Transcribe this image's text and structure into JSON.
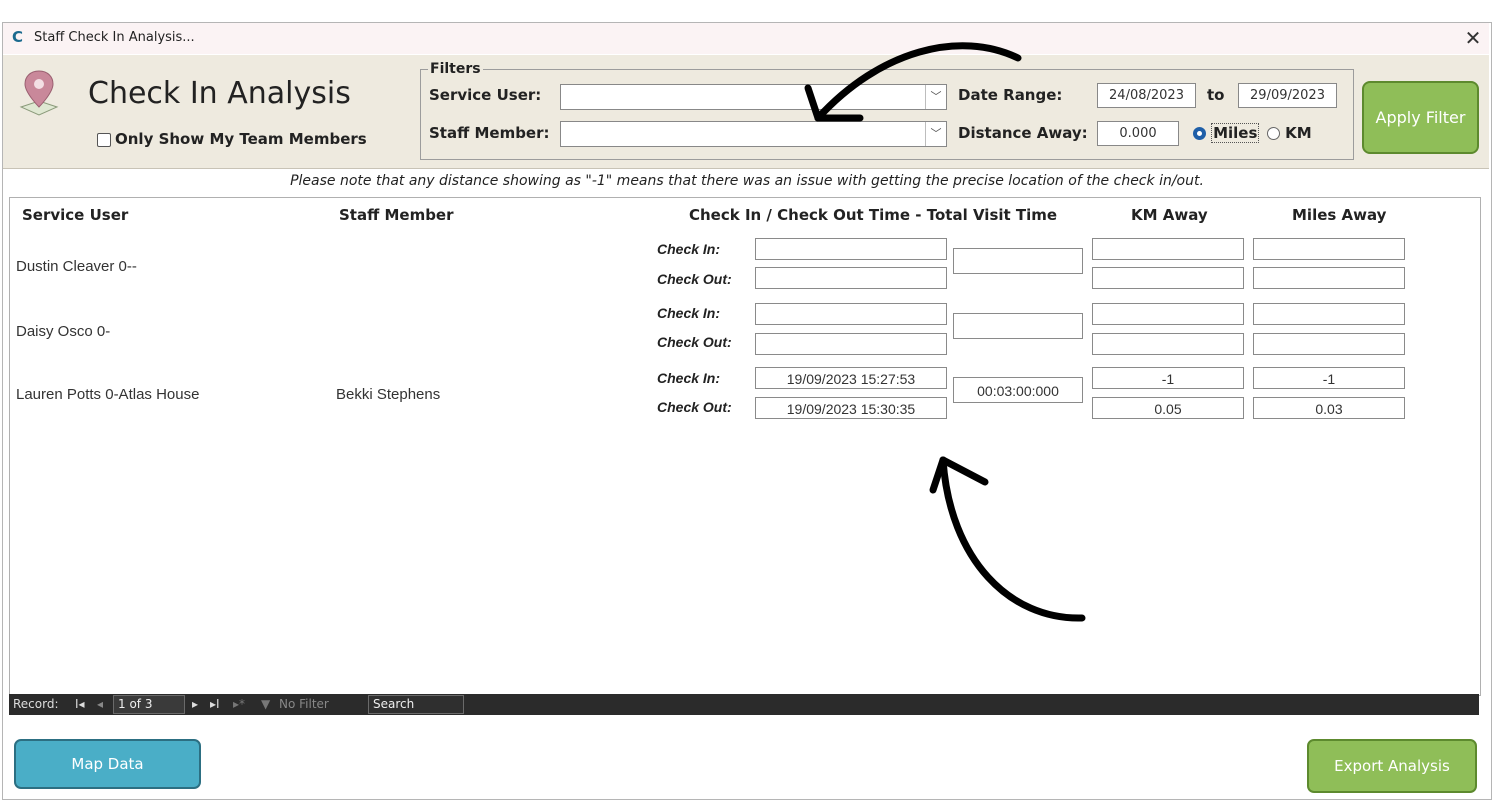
{
  "window": {
    "title": "Staff Check In Analysis...",
    "app_icon": "C",
    "close_glyph": "✕"
  },
  "header": {
    "title": "Check In Analysis",
    "only_my_team_label": "Only Show My Team Members",
    "only_my_team_checked": false
  },
  "filters": {
    "legend": "Filters",
    "service_user_label": "Service User:",
    "service_user_value": "",
    "staff_member_label": "Staff Member:",
    "staff_member_value": "",
    "date_range_label": "Date Range:",
    "date_from": "24/08/2023",
    "date_to_label": "to",
    "date_to": "29/09/2023",
    "distance_label": "Distance Away:",
    "distance_value": "0.000",
    "unit_miles": "Miles",
    "unit_km": "KM",
    "selected_unit": "Miles",
    "apply_label": "Apply Filter"
  },
  "note": "Please note that any distance showing as \"-1\" means that there was an issue with getting the precise location of the check in/out.",
  "columns": {
    "service_user": "Service User",
    "staff_member": "Staff Member",
    "times": "Check In / Check Out Time - Total Visit Time",
    "km": "KM Away",
    "miles": "Miles Away"
  },
  "check_in_label": "Check In:",
  "check_out_label": "Check Out:",
  "records": [
    {
      "service_user": "Dustin Cleaver 0--",
      "staff_member": "",
      "check_in": "",
      "check_out": "",
      "total": "",
      "km_in": "",
      "km_out": "",
      "miles_in": "",
      "miles_out": ""
    },
    {
      "service_user": "Daisy Osco 0-",
      "staff_member": "",
      "check_in": "",
      "check_out": "",
      "total": "",
      "km_in": "",
      "km_out": "",
      "miles_in": "",
      "miles_out": ""
    },
    {
      "service_user": "Lauren Potts 0-Atlas House",
      "staff_member": "Bekki Stephens",
      "check_in": "19/09/2023 15:27:53",
      "check_out": "19/09/2023 15:30:35",
      "total": "00:03:00:000",
      "km_in": "-1",
      "km_out": "0.05",
      "miles_in": "-1",
      "miles_out": "0.03"
    }
  ],
  "navigation": {
    "record_label": "Record:",
    "first_glyph": "I◂",
    "prev_glyph": "◂",
    "position": "1 of 3",
    "next_glyph": "▸",
    "last_glyph": "▸I",
    "new_glyph": "▸*",
    "no_filter_label": "No Filter",
    "search_label": "Search"
  },
  "buttons": {
    "map_data": "Map Data",
    "export_analysis": "Export Analysis"
  },
  "colors": {
    "header_bg": "#eeeadf",
    "apply_green": "#8fbe58",
    "map_blue": "#4aaec7",
    "title_bg": "#fbf3f4"
  }
}
